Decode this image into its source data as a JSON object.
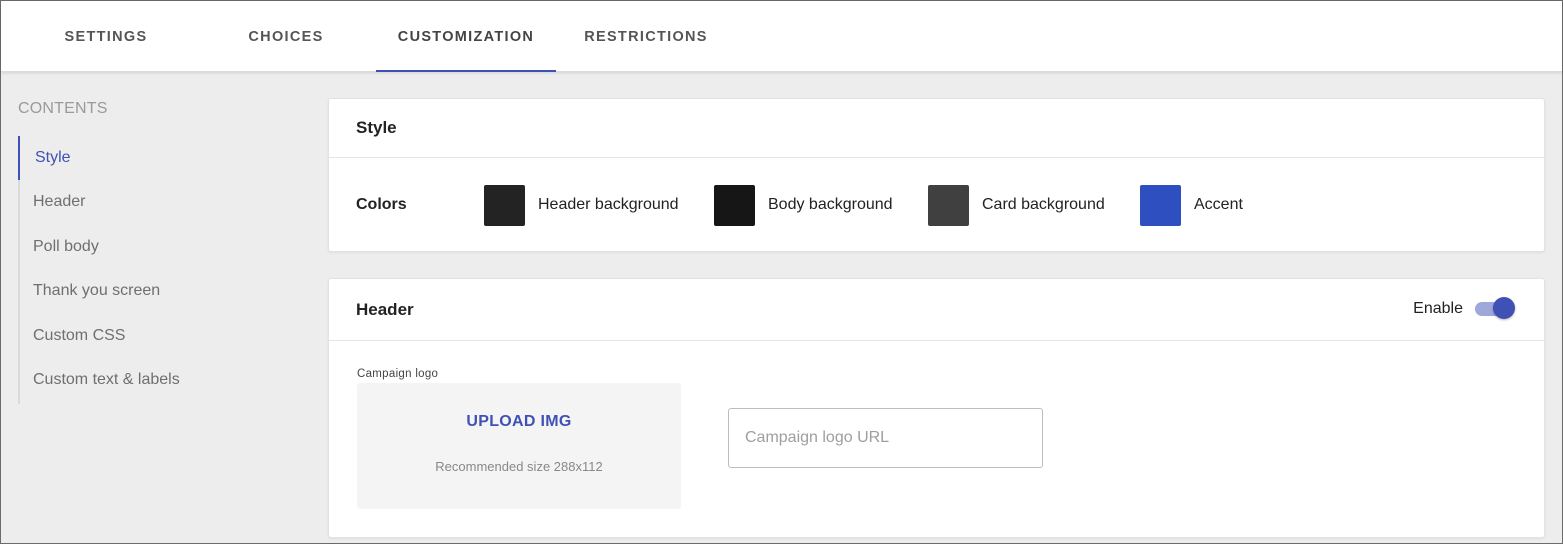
{
  "tabs": [
    {
      "label": "SETTINGS",
      "active": false
    },
    {
      "label": "CHOICES",
      "active": false
    },
    {
      "label": "CUSTOMIZATION",
      "active": true
    },
    {
      "label": "RESTRICTIONS",
      "active": false
    }
  ],
  "contents": {
    "title": "CONTENTS",
    "items": [
      {
        "label": "Style",
        "active": true
      },
      {
        "label": "Header",
        "active": false
      },
      {
        "label": "Poll body",
        "active": false
      },
      {
        "label": "Thank you screen",
        "active": false
      },
      {
        "label": "Custom CSS",
        "active": false
      },
      {
        "label": "Custom text & labels",
        "active": false
      }
    ]
  },
  "style_card": {
    "title": "Style",
    "colors_label": "Colors",
    "swatches": [
      {
        "label": "Header background",
        "color": "#232323"
      },
      {
        "label": "Body background",
        "color": "#161616"
      },
      {
        "label": "Card background",
        "color": "#404040"
      },
      {
        "label": "Accent",
        "color": "#2e4fbf"
      }
    ]
  },
  "header_card": {
    "title": "Header",
    "enable_label": "Enable",
    "enabled": true,
    "logo_label": "Campaign logo",
    "upload_label": "UPLOAD IMG",
    "upload_hint": "Recommended size 288x112",
    "url_placeholder": "Campaign logo URL",
    "url_value": ""
  },
  "colors": {
    "accent": "#3f51b5"
  }
}
